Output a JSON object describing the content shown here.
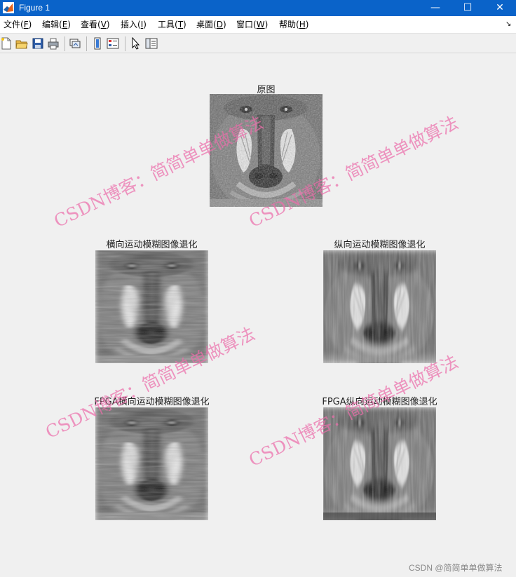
{
  "window": {
    "title": "Figure 1",
    "minimize_glyph": "—",
    "maximize_glyph": "☐",
    "close_glyph": "✕"
  },
  "menu": {
    "items": [
      {
        "label": "文件(",
        "key": "F",
        "end": ")"
      },
      {
        "label": "编辑(",
        "key": "E",
        "end": ")"
      },
      {
        "label": "查看(",
        "key": "V",
        "end": ")"
      },
      {
        "label": "插入(",
        "key": "I",
        "end": ")"
      },
      {
        "label": "工具(",
        "key": "T",
        "end": ")"
      },
      {
        "label": "桌面(",
        "key": "D",
        "end": ")"
      },
      {
        "label": "窗口(",
        "key": "W",
        "end": ")"
      },
      {
        "label": "帮助(",
        "key": "H",
        "end": ")"
      }
    ],
    "overflow_glyph": "↘"
  },
  "toolbar": {
    "buttons": [
      "new-figure-icon",
      "open-file-icon",
      "save-icon",
      "print-icon",
      "link-plot-icon",
      "insert-colorbar-icon",
      "insert-legend-icon",
      "edit-plot-icon",
      "property-inspector-icon"
    ]
  },
  "figure": {
    "axes": [
      {
        "title": "原图",
        "image": "mandrill original grayscale"
      },
      {
        "title": "横向运动模糊图像退化",
        "image": "mandrill horizontal motion blur"
      },
      {
        "title": "纵向运动模糊图像退化",
        "image": "mandrill vertical motion blur"
      },
      {
        "title": "FPGA横向运动模糊图像退化",
        "image": "mandrill horizontal motion blur (FPGA)"
      },
      {
        "title": "FPGA纵向运动模糊图像退化",
        "image": "mandrill vertical motion blur (FPGA)"
      }
    ]
  },
  "watermarks": {
    "text": "CSDN博客：简简单单做算法",
    "footer": "CSDN @简简单单做算法",
    "color": "#ec6eaa"
  }
}
